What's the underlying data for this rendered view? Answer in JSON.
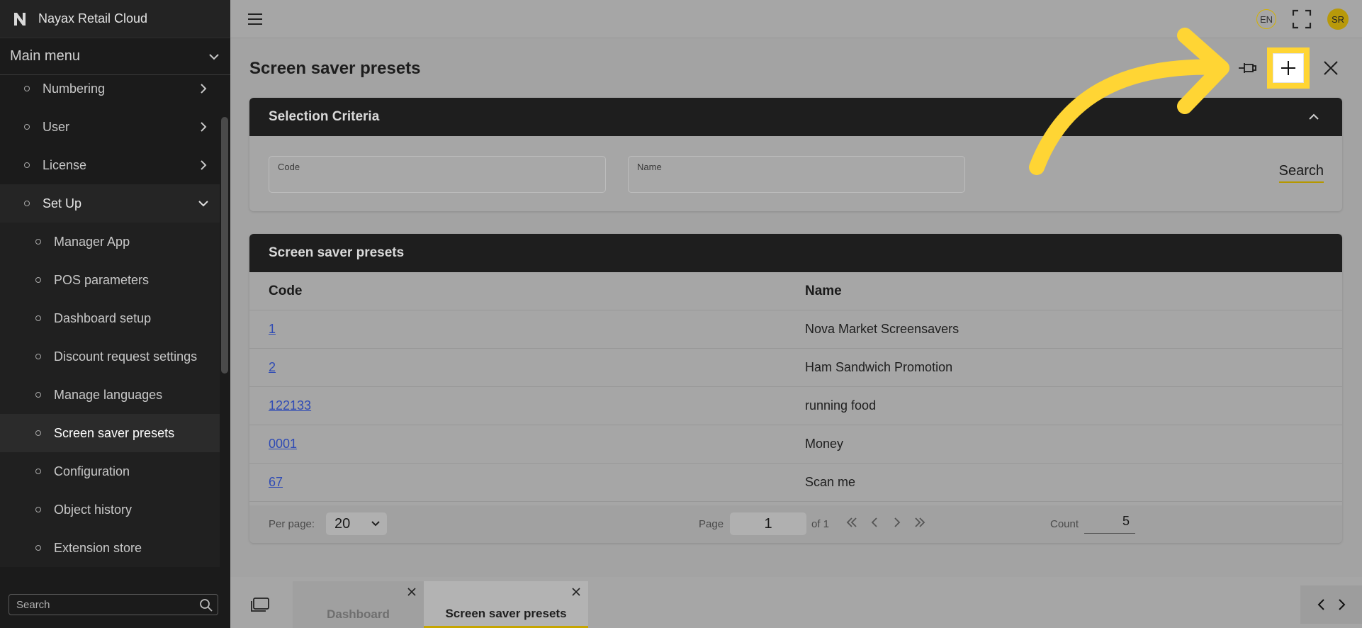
{
  "app": {
    "brand": "Nayax Retail Cloud"
  },
  "sidebar": {
    "main_menu_label": "Main menu",
    "items": [
      {
        "label": "Numbering"
      },
      {
        "label": "User"
      },
      {
        "label": "License"
      },
      {
        "label": "Set Up"
      }
    ],
    "setup_items": [
      {
        "label": "Manager App"
      },
      {
        "label": "POS parameters"
      },
      {
        "label": "Dashboard setup"
      },
      {
        "label": "Discount request settings"
      },
      {
        "label": "Manage languages"
      },
      {
        "label": "Screen saver presets"
      },
      {
        "label": "Configuration"
      },
      {
        "label": "Object history"
      },
      {
        "label": "Extension store"
      }
    ],
    "search_placeholder": "Search"
  },
  "header": {
    "language": "EN",
    "user_initials": "SR"
  },
  "page": {
    "title": "Screen saver presets"
  },
  "criteria": {
    "title": "Selection Criteria",
    "code_label": "Code",
    "name_label": "Name",
    "search_label": "Search"
  },
  "results": {
    "title": "Screen saver presets",
    "columns": {
      "code": "Code",
      "name": "Name"
    },
    "rows": [
      {
        "code": "1",
        "name": "Nova Market Screensavers"
      },
      {
        "code": "2",
        "name": "Ham Sandwich Promotion"
      },
      {
        "code": "122133",
        "name": "running food"
      },
      {
        "code": "0001",
        "name": "Money"
      },
      {
        "code": "67",
        "name": "Scan me"
      }
    ]
  },
  "pager": {
    "per_page_label": "Per page:",
    "per_page_value": "20",
    "page_label": "Page",
    "page_value": "1",
    "of_label": "of 1",
    "count_label": "Count",
    "count_value": "5"
  },
  "tabs": [
    {
      "label": "Dashboard"
    },
    {
      "label": "Screen saver presets"
    }
  ],
  "colors": {
    "accent": "#ffd534",
    "link": "#2f4bb5",
    "sidebar_bg": "#1b1b1b"
  }
}
